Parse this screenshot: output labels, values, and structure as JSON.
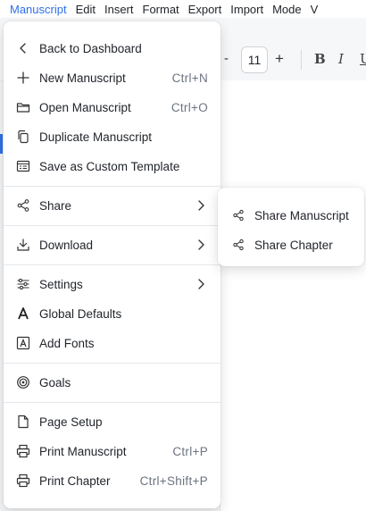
{
  "menubar": {
    "items": [
      "Manuscript",
      "Edit",
      "Insert",
      "Format",
      "Export",
      "Import",
      "Mode",
      "V"
    ]
  },
  "toolbar": {
    "font_size": "11",
    "minus": "-",
    "plus": "+",
    "bold": "B",
    "italic": "I",
    "underline": "U"
  },
  "menu": {
    "back": "Back to Dashboard",
    "new": {
      "label": "New Manuscript",
      "shortcut": "Ctrl+N"
    },
    "open": {
      "label": "Open Manuscript",
      "shortcut": "Ctrl+O"
    },
    "duplicate": "Duplicate Manuscript",
    "save_template": "Save as Custom Template",
    "share": "Share",
    "download": "Download",
    "settings": "Settings",
    "global_defaults": "Global Defaults",
    "add_fonts": "Add Fonts",
    "goals": "Goals",
    "page_setup": "Page Setup",
    "print_manuscript": {
      "label": "Print Manuscript",
      "shortcut": "Ctrl+P"
    },
    "print_chapter": {
      "label": "Print Chapter",
      "shortcut": "Ctrl+Shift+P"
    }
  },
  "share_submenu": {
    "share_manuscript": "Share Manuscript",
    "share_chapter": "Share Chapter"
  },
  "icons": {
    "back": "chevron-left-icon",
    "new": "plus-icon",
    "open": "folder-icon",
    "duplicate": "copy-icon",
    "save_template": "template-icon",
    "share": "share-icon",
    "download": "download-icon",
    "settings": "sliders-icon",
    "global_defaults": "letter-a-icon",
    "add_fonts": "font-box-icon",
    "goals": "target-icon",
    "page_setup": "file-icon",
    "print": "printer-icon"
  },
  "colors": {
    "accent": "#2f6fe8",
    "text": "#1f2329",
    "shortcut": "#6b7280"
  }
}
